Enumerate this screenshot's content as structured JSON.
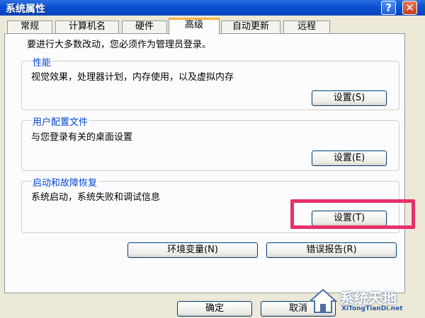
{
  "window": {
    "title": "系统属性",
    "help_glyph": "?",
    "close_glyph": "✕"
  },
  "tabs": [
    {
      "label": "常规"
    },
    {
      "label": "计算机名"
    },
    {
      "label": "硬件"
    },
    {
      "label": "高级"
    },
    {
      "label": "自动更新"
    },
    {
      "label": "远程"
    }
  ],
  "active_tab": "高级",
  "admin_notice": "要进行大多数改动，您必须作为管理员登录。",
  "performance": {
    "label": "性能",
    "description": "视觉效果，处理器计划，内存使用，以及虚拟内存",
    "button": "设置(S)"
  },
  "user_profiles": {
    "label": "用户配置文件",
    "description": "与您登录有关的桌面设置",
    "button": "设置(E)"
  },
  "startup_recovery": {
    "label": "启动和故障恢复",
    "description": "系统启动，系统失败和调试信息",
    "button": "设置(T)"
  },
  "env_button": "环境变量(N)",
  "error_report_button": "错误报告(R)",
  "ok_button": "确定",
  "cancel_button": "取消",
  "watermark": {
    "cn": "系统天地",
    "en": "XiTongTianDi.net"
  },
  "highlight_color": "#e8306a"
}
